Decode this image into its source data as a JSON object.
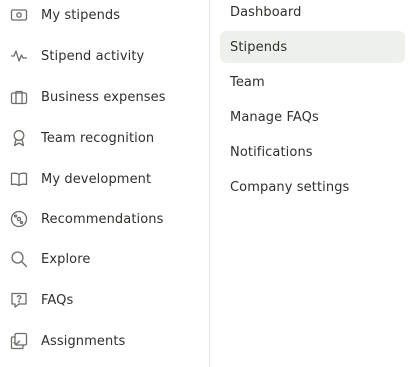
{
  "left_nav": {
    "items": [
      {
        "label": "My stipends",
        "icon": "money-icon"
      },
      {
        "label": "Stipend activity",
        "icon": "activity-icon"
      },
      {
        "label": "Business expenses",
        "icon": "briefcase-icon"
      },
      {
        "label": "Team recognition",
        "icon": "award-icon"
      },
      {
        "label": "My development",
        "icon": "book-icon"
      },
      {
        "label": "Recommendations",
        "icon": "compass-icon"
      },
      {
        "label": "Explore",
        "icon": "search-icon"
      },
      {
        "label": "FAQs",
        "icon": "help-icon"
      },
      {
        "label": "Assignments",
        "icon": "assignments-icon"
      }
    ]
  },
  "right_nav": {
    "items": [
      {
        "label": "Dashboard",
        "active": false
      },
      {
        "label": "Stipends",
        "active": true
      },
      {
        "label": "Team",
        "active": false
      },
      {
        "label": "Manage FAQs",
        "active": false
      },
      {
        "label": "Notifications",
        "active": false
      },
      {
        "label": "Company settings",
        "active": false
      }
    ]
  },
  "colors": {
    "text": "#2f302c",
    "icon": "#6b6d66",
    "active_bg": "#eef1eb",
    "divider": "#e6e6e2"
  }
}
